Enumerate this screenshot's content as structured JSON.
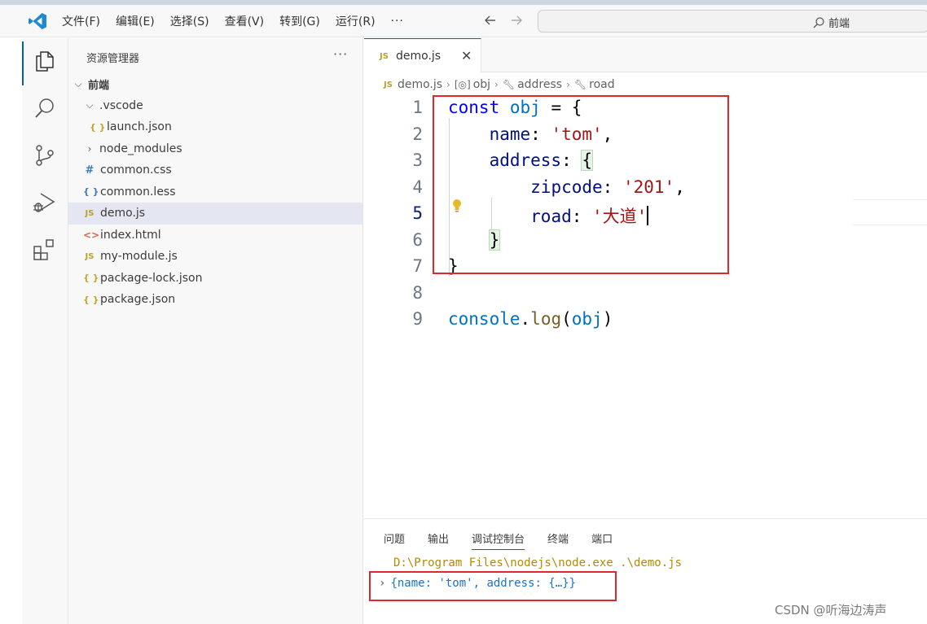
{
  "menu": [
    "文件(F)",
    "编辑(E)",
    "选择(S)",
    "查看(V)",
    "转到(G)",
    "运行(R)"
  ],
  "menu_more": "···",
  "search": {
    "text": "前端"
  },
  "sidebar": {
    "title": "资源管理器",
    "more": "···",
    "root": "前端",
    "items": [
      {
        "label": ".vscode",
        "type": "folder-open",
        "indent": 1
      },
      {
        "label": "launch.json",
        "type": "json",
        "indent": 2
      },
      {
        "label": "node_modules",
        "type": "folder",
        "indent": 1
      },
      {
        "label": "common.css",
        "type": "css",
        "indent": 1
      },
      {
        "label": "common.less",
        "type": "less",
        "indent": 1
      },
      {
        "label": "demo.js",
        "type": "js",
        "indent": 1,
        "selected": true
      },
      {
        "label": "index.html",
        "type": "html",
        "indent": 1
      },
      {
        "label": "my-module.js",
        "type": "js",
        "indent": 1
      },
      {
        "label": "package-lock.json",
        "type": "json",
        "indent": 1
      },
      {
        "label": "package.json",
        "type": "json",
        "indent": 1
      }
    ]
  },
  "editor": {
    "tab": {
      "label": "demo.js",
      "icon": "JS",
      "close": "✕"
    },
    "breadcrumb": [
      "demo.js",
      "obj",
      "address",
      "road"
    ],
    "line_numbers": [
      "1",
      "2",
      "3",
      "4",
      "5",
      "6",
      "7",
      "8",
      "9"
    ],
    "current_line": "5"
  },
  "panel": {
    "tabs": [
      "问题",
      "输出",
      "调试控制台",
      "终端",
      "端口"
    ],
    "active_tab": "调试控制台",
    "command": "D:\\Program Files\\nodejs\\node.exe .\\demo.js",
    "result": "{name: 'tom', address: {…}}"
  },
  "watermark": "CSDN @听海边涛声",
  "colors": {
    "accent": "#005fb8",
    "highlight_box": "#e0262e"
  }
}
